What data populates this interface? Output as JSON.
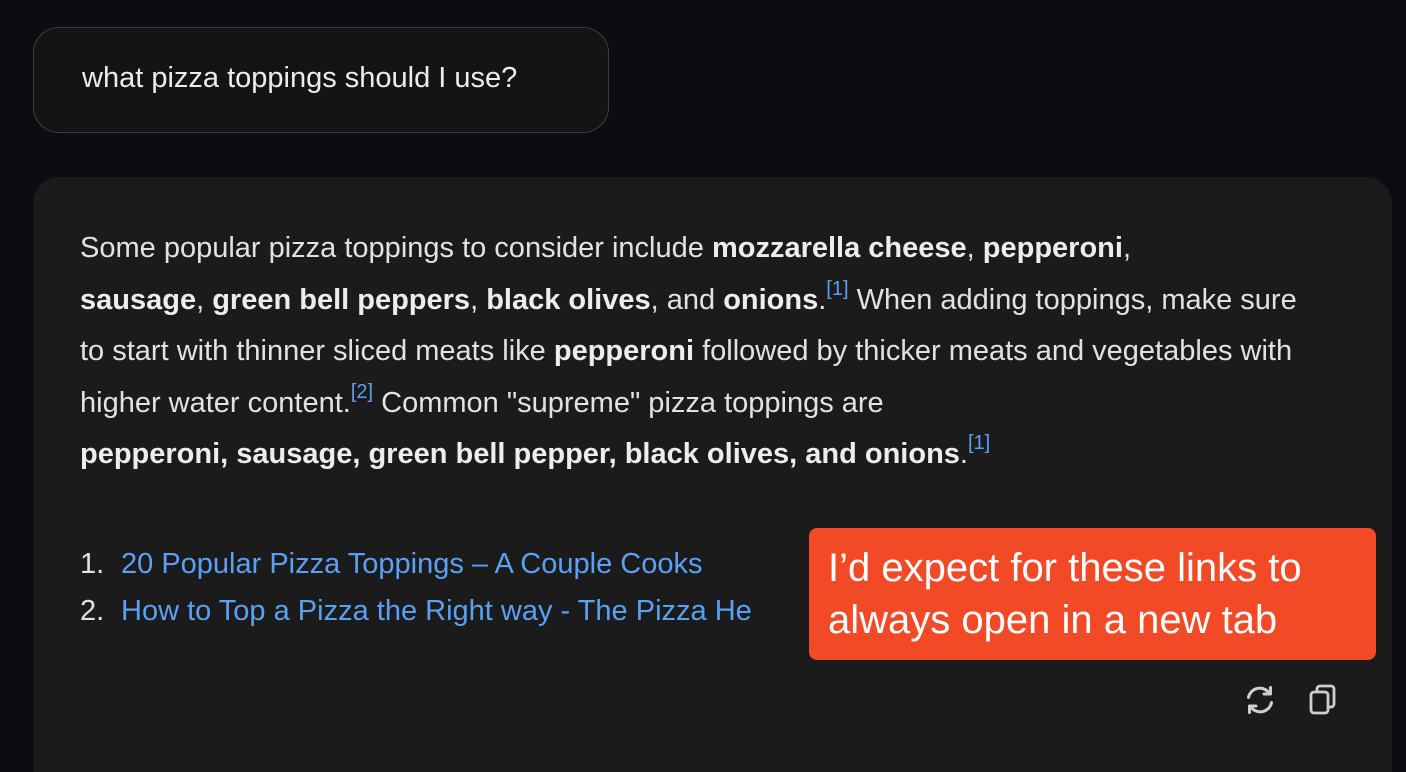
{
  "user_message": "what pizza toppings should I use?",
  "answer": {
    "t1": "Some popular pizza toppings to consider include ",
    "b1": "mozzarella cheese",
    "t2": ", ",
    "b2": "pepperoni",
    "t3": ", ",
    "b3": "sausage",
    "t4": ", ",
    "b4": "green bell peppers",
    "t5": ", ",
    "b5": "black olives",
    "t6": ", and ",
    "b6": "onions",
    "t7": ".",
    "cite1": "[1]",
    "t8": " When adding toppings, make sure to start with thinner sliced meats like ",
    "b7": "pepperoni",
    "t9": " followed by thicker meats and vegetables with higher water content.",
    "cite2": "[2]",
    "t10": " Common \"supreme\" pizza toppings are ",
    "b8": "pepperoni, sausage, green bell pepper, black olives, and onions",
    "t11": ".",
    "cite3": "[1]"
  },
  "sources": [
    {
      "number": "1.",
      "title": "20 Popular Pizza Toppings – A Couple Cooks"
    },
    {
      "number": "2.",
      "title": "How to Top a Pizza the Right way - The Pizza He"
    }
  ],
  "actions": {
    "regenerate_icon": "refresh-icon",
    "copy_icon": "copy-icon"
  },
  "annotation": {
    "line1": "I’d expect for these links to",
    "line2": "always open in a new tab"
  },
  "colors": {
    "background": "#0b0d12",
    "card": "#1b1b1c",
    "link": "#5aa0f5",
    "annotation": "#f24a26"
  }
}
